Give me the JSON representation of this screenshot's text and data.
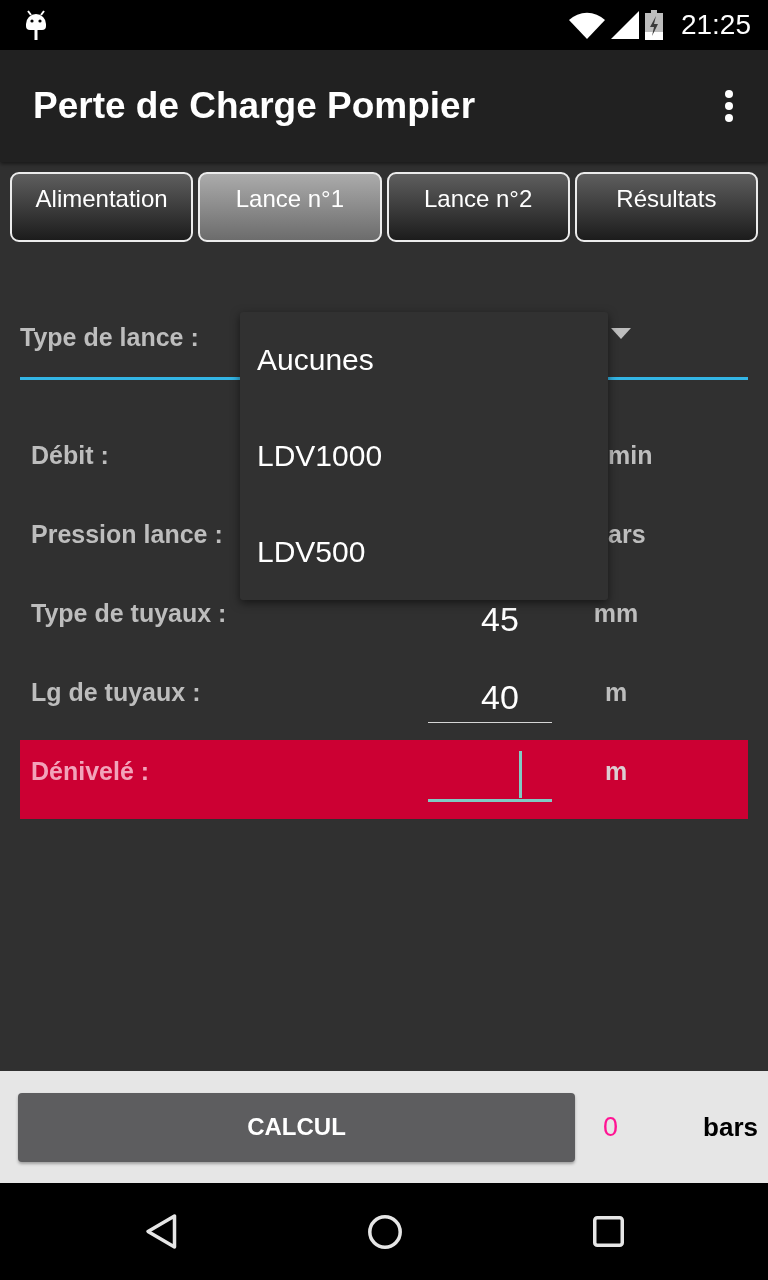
{
  "status_bar": {
    "time": "21:25"
  },
  "app_bar": {
    "title": "Perte de Charge Pompier"
  },
  "tabs": [
    {
      "label": "Alimentation",
      "selected": false
    },
    {
      "label": "Lance n°1",
      "selected": true
    },
    {
      "label": "Lance n°2",
      "selected": false
    },
    {
      "label": "Résultats",
      "selected": false
    }
  ],
  "lance_type": {
    "label": "Type de lance :",
    "expanded": true,
    "options": [
      {
        "label": "Aucunes"
      },
      {
        "label": "LDV1000"
      },
      {
        "label": "LDV500"
      }
    ]
  },
  "rows": [
    {
      "kind": "covered",
      "label": "Débit :",
      "unit": "min",
      "highlighted": false
    },
    {
      "kind": "covered",
      "label": "Pression lance :",
      "unit": "ars",
      "highlighted": false
    },
    {
      "kind": "select",
      "label": "Type de tuyaux :",
      "value": "45",
      "unit": "mm",
      "highlighted": false
    },
    {
      "kind": "input",
      "label": "Lg de tuyaux :",
      "value": "40",
      "unit": "m",
      "focused": false,
      "highlighted": false
    },
    {
      "kind": "input",
      "label": "Dénivelé :",
      "unit": "m",
      "focused": true,
      "highlighted": true
    }
  ],
  "calculation": {
    "button": "CALCUL",
    "result": "0",
    "unit": "bars"
  }
}
